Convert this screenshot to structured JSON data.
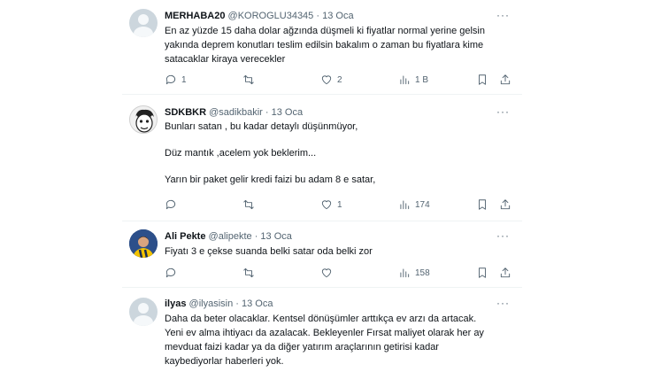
{
  "tweets": [
    {
      "name": "MERHABA20",
      "handle": "@KOROGLU34345",
      "dot": "·",
      "time": "13 Oca",
      "avatar": "default-avatar",
      "lines": [
        "En az yüzde 15 daha dolar ağzında düşmeli ki fiyatlar normal yerine gelsin",
        "yakında deprem konutları teslim edilsin bakalım o zaman bu fiyatlara kime",
        "satacaklar kiraya verecekler"
      ],
      "replies": "1",
      "retweets": "",
      "likes": "2",
      "views": "1 B"
    },
    {
      "name": "SDKBKR",
      "handle": "@sadikbakir",
      "dot": "·",
      "time": "13 Oca",
      "avatar": "cartoon-avatar",
      "lines": [
        "Bunları satan , bu kadar detaylı düşünmüyor,",
        "",
        "Düz mantık ,acelem yok beklerim...",
        "",
        "Yarın bir paket gelir kredi faizi bu adam 8 e satar,"
      ],
      "replies": "",
      "retweets": "",
      "likes": "1",
      "views": "174"
    },
    {
      "name": "Ali Pekte",
      "handle": "@alipekte",
      "dot": "·",
      "time": "13 Oca",
      "avatar": "photo-avatar",
      "lines": [
        "Fiyatı 3 e çekse suanda belki satar oda belki zor"
      ],
      "replies": "",
      "retweets": "",
      "likes": "",
      "views": "158"
    },
    {
      "name": "ilyas",
      "handle": "@ilyasisin",
      "dot": "·",
      "time": "13 Oca",
      "avatar": "default-avatar",
      "lines": [
        "Daha da beter olacaklar. Kentsel dönüşümler arttıkça ev arzı da artacak.",
        "Yeni ev alma ihtiyacı da azalacak. Bekleyenler Fırsat maliyet olarak her ay",
        "mevduat faizi kadar ya da diğer yatırım araçlarının getirisi kadar",
        "kaybediyorlar haberleri yok."
      ]
    }
  ],
  "more_label": "···"
}
